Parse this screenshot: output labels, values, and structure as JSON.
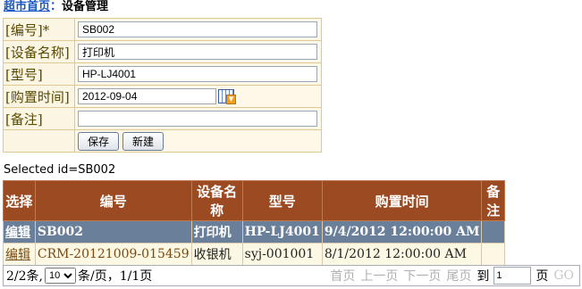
{
  "breadcrumb": {
    "home": "超市首页",
    "sep": "：",
    "current": "设备管理"
  },
  "form": {
    "code_label": "[编号]*",
    "code_value": "SB002",
    "name_label": "[设备名称]",
    "name_value": "打印机",
    "model_label": "[型号]",
    "model_value": "HP-LJ4001",
    "date_label": "[购置时间]",
    "date_value": "2012-09-04",
    "remark_label": "[备注]",
    "remark_value": "",
    "save_label": "保存",
    "new_label": "新建"
  },
  "selected_text": "Selected id=SB002",
  "table": {
    "headers": [
      "选择",
      "编号",
      "设备名称",
      "型号",
      "购置时间",
      "备注"
    ],
    "rows": [
      {
        "select": "编辑",
        "code": "SB002",
        "name": "打印机",
        "model": "HP-LJ4001",
        "date": "9/4/2012 12:00:00 AM",
        "remark": ""
      },
      {
        "select": "编辑",
        "code": "CRM-20121009-015459",
        "name": "收银机",
        "model": "syj-001001",
        "date": "8/1/2012 12:00:00 AM",
        "remark": ""
      }
    ]
  },
  "pager": {
    "count": "2/2条,",
    "page_size": "10",
    "per_page": "条/页，",
    "page_info": "1/1页",
    "first": "首页",
    "prev": "上一页",
    "next": "下一页",
    "last": "尾页",
    "goto": "到",
    "goto_value": "1",
    "page_unit": "页",
    "go": "GO"
  },
  "colors": {
    "header_bg": "#9b4a22",
    "selected_row_bg": "#6a7f9a",
    "form_bg": "#fdf8e8",
    "link": "#1a56c2"
  }
}
